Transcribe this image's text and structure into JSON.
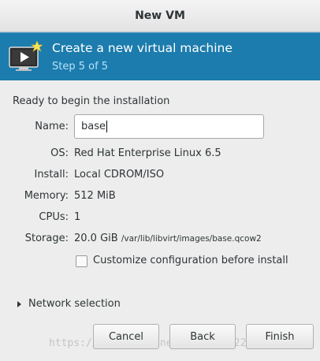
{
  "window": {
    "title": "New VM"
  },
  "banner": {
    "title": "Create a new virtual machine",
    "step": "Step 5 of 5",
    "icon": "monitor-play-icon"
  },
  "summary": {
    "heading": "Ready to begin the installation",
    "name_label": "Name:",
    "name_value": "base",
    "os_label": "OS:",
    "os_value": "Red Hat Enterprise Linux 6.5",
    "install_label": "Install:",
    "install_value": "Local CDROM/ISO",
    "memory_label": "Memory:",
    "memory_value": "512 MiB",
    "cpus_label": "CPUs:",
    "cpus_value": "1",
    "storage_label": "Storage:",
    "storage_size": "20.0 GiB",
    "storage_path": "/var/lib/libvirt/images/base.qcow2"
  },
  "customize": {
    "label": "Customize configuration before install",
    "checked": false
  },
  "network": {
    "label": "Network selection"
  },
  "buttons": {
    "cancel": "Cancel",
    "back": "Back",
    "finish": "Finish"
  },
  "watermark": "https://blog.csdn.net/qq_38622229",
  "colors": {
    "banner": "#1c7cad",
    "step_text": "#b8e1fb",
    "background": "#ededed"
  }
}
